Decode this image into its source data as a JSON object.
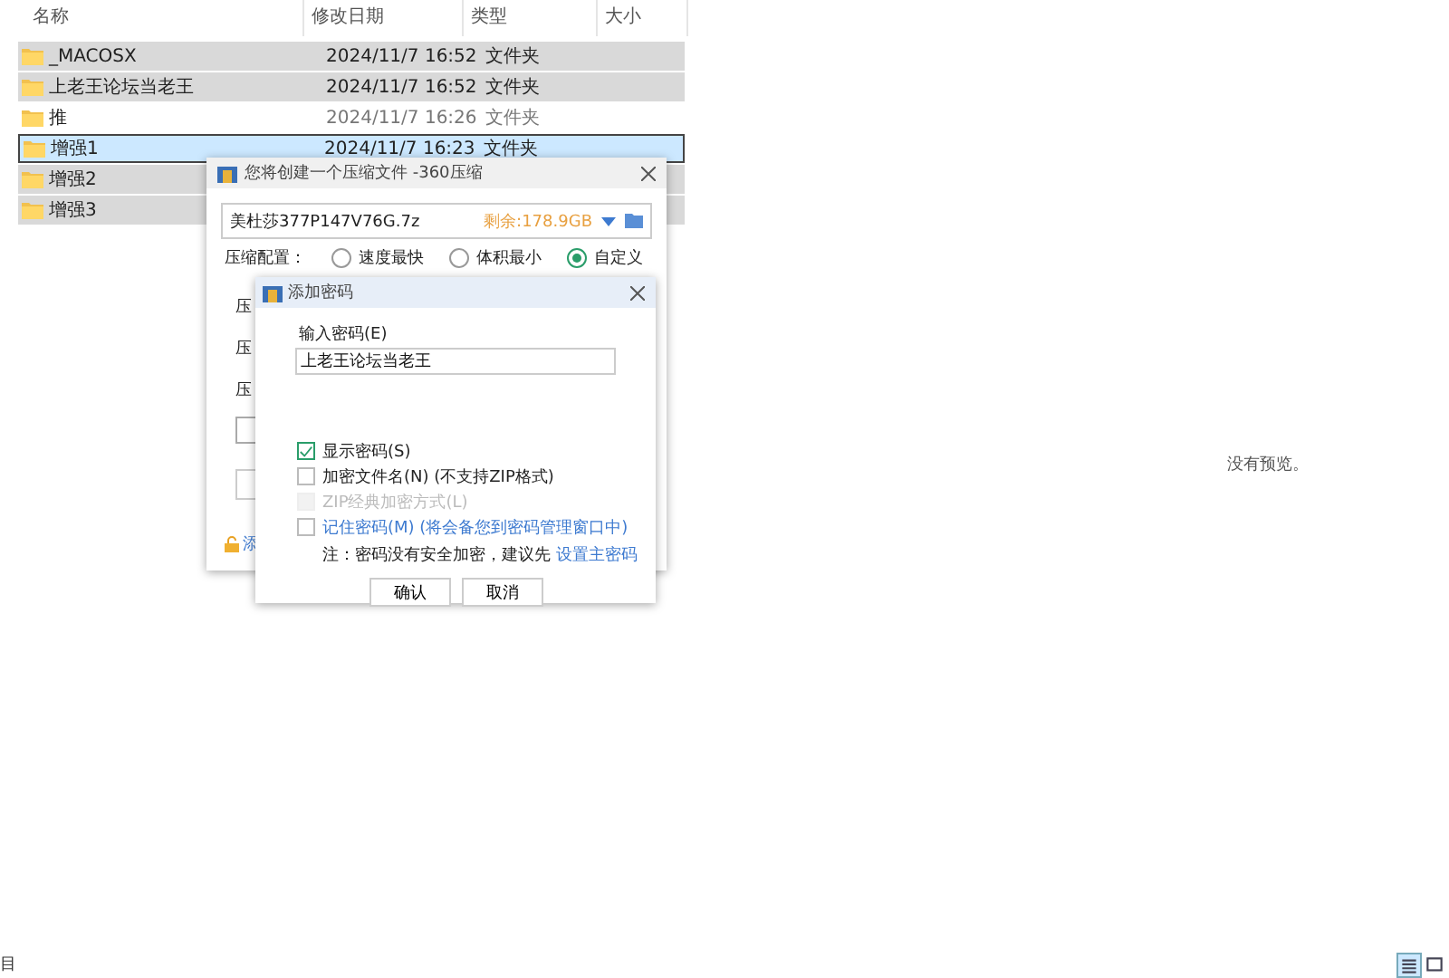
{
  "explorer": {
    "columns": [
      "名称",
      "修改日期",
      "类型",
      "大小"
    ],
    "rows": [
      {
        "name": "_MACOSX",
        "modified": "2024/11/7 16:52",
        "type": "文件夹",
        "selected": true,
        "focused": false
      },
      {
        "name": "上老王论坛当老王",
        "modified": "2024/11/7 16:52",
        "type": "文件夹",
        "selected": true,
        "focused": false
      },
      {
        "name": "推",
        "modified": "2024/11/7 16:26",
        "type": "文件夹",
        "selected": false,
        "focused": false
      },
      {
        "name": "增强1",
        "modified": "2024/11/7 16:23",
        "type": "文件夹",
        "selected": true,
        "focused": true
      },
      {
        "name": "增强2",
        "modified": "",
        "type": "",
        "selected": true,
        "focused": false
      },
      {
        "name": "增强3",
        "modified": "",
        "type": "",
        "selected": true,
        "focused": false
      }
    ]
  },
  "preview": {
    "message": "没有预览。"
  },
  "status_bar": {
    "text": "目",
    "views": [
      {
        "kind": "details",
        "selected": true
      },
      {
        "kind": "tiles",
        "selected": false
      }
    ]
  },
  "zip_dialog": {
    "title": "您将创建一个压缩文件 -360压缩",
    "archive_name": "美杜莎377P147V76G.7z",
    "free_space": "剩余:178.9GB",
    "preset_label": "压缩配置：",
    "presets": [
      {
        "label": "速度最快",
        "selected": false
      },
      {
        "label": "体积最小",
        "selected": false
      },
      {
        "label": "自定义",
        "selected": true
      }
    ],
    "covered_labels": [
      "压",
      "压",
      "压"
    ],
    "covered_link": "添"
  },
  "password_dialog": {
    "title": "添加密码",
    "field_label": "输入密码(E)",
    "value": "上老王论坛当老王",
    "options": [
      {
        "label": "显示密码(S)",
        "kind": "plain",
        "checked": true,
        "disabled": false
      },
      {
        "label": "加密文件名(N) (不支持ZIP格式)",
        "kind": "plain",
        "checked": false,
        "disabled": false
      },
      {
        "label": "ZIP经典加密方式(L)",
        "kind": "plain",
        "checked": false,
        "disabled": true
      },
      {
        "label": "记住密码(M) (将会备您到密码管理窗口中)",
        "kind": "link",
        "checked": false,
        "disabled": false
      }
    ],
    "note": "注：密码没有安全加密，建议先",
    "note_link": "设置主密码",
    "buttons": [
      "确认",
      "取消"
    ]
  }
}
